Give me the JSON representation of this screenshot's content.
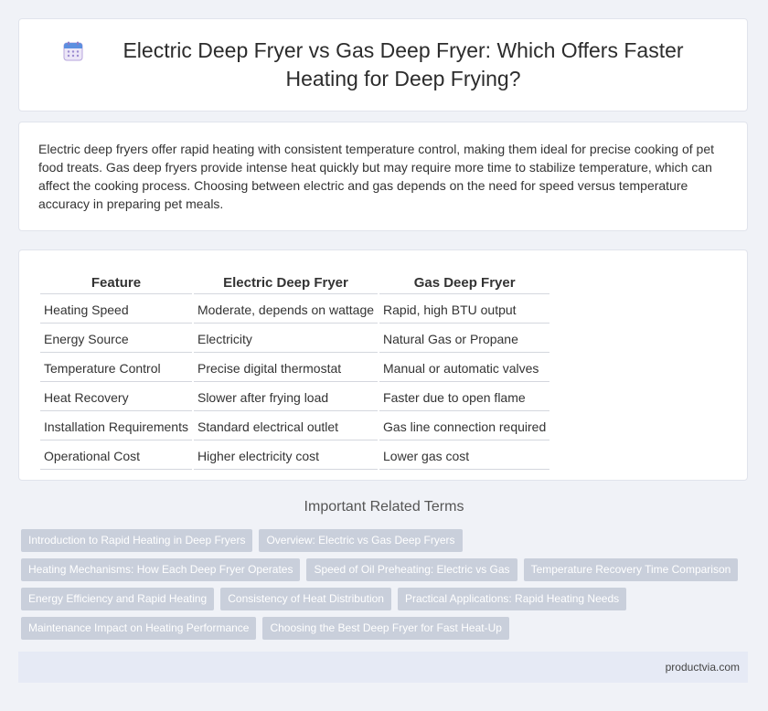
{
  "header": {
    "title": "Electric Deep Fryer vs Gas Deep Fryer: Which Offers Faster Heating for Deep Frying?",
    "icon": "calendar-icon"
  },
  "summary": {
    "text": "Electric deep fryers offer rapid heating with consistent temperature control, making them ideal for precise cooking of pet food treats. Gas deep fryers provide intense heat quickly but may require more time to stabilize temperature, which can affect the cooking process. Choosing between electric and gas depends on the need for speed versus temperature accuracy in preparing pet meals."
  },
  "table": {
    "headers": [
      "Feature",
      "Electric Deep Fryer",
      "Gas Deep Fryer"
    ],
    "rows": [
      [
        "Heating Speed",
        "Moderate, depends on wattage",
        "Rapid, high BTU output"
      ],
      [
        "Energy Source",
        "Electricity",
        "Natural Gas or Propane"
      ],
      [
        "Temperature Control",
        "Precise digital thermostat",
        "Manual or automatic valves"
      ],
      [
        "Heat Recovery",
        "Slower after frying load",
        "Faster due to open flame"
      ],
      [
        "Installation Requirements",
        "Standard electrical outlet",
        "Gas line connection required"
      ],
      [
        "Operational Cost",
        "Higher electricity cost",
        "Lower gas cost"
      ]
    ]
  },
  "related": {
    "heading": "Important Related Terms",
    "tags": [
      "Introduction to Rapid Heating in Deep Fryers",
      "Overview: Electric vs Gas Deep Fryers",
      "Heating Mechanisms: How Each Deep Fryer Operates",
      "Speed of Oil Preheating: Electric vs Gas",
      "Temperature Recovery Time Comparison",
      "Energy Efficiency and Rapid Heating",
      "Consistency of Heat Distribution",
      "Practical Applications: Rapid Heating Needs",
      "Maintenance Impact on Heating Performance",
      "Choosing the Best Deep Fryer for Fast Heat-Up"
    ]
  },
  "footer": {
    "brand": "productvia.com"
  },
  "colors": {
    "background": "#f0f2f7",
    "tag_bg": "#c9cfdb",
    "footer_bg": "#e6eaf5"
  }
}
